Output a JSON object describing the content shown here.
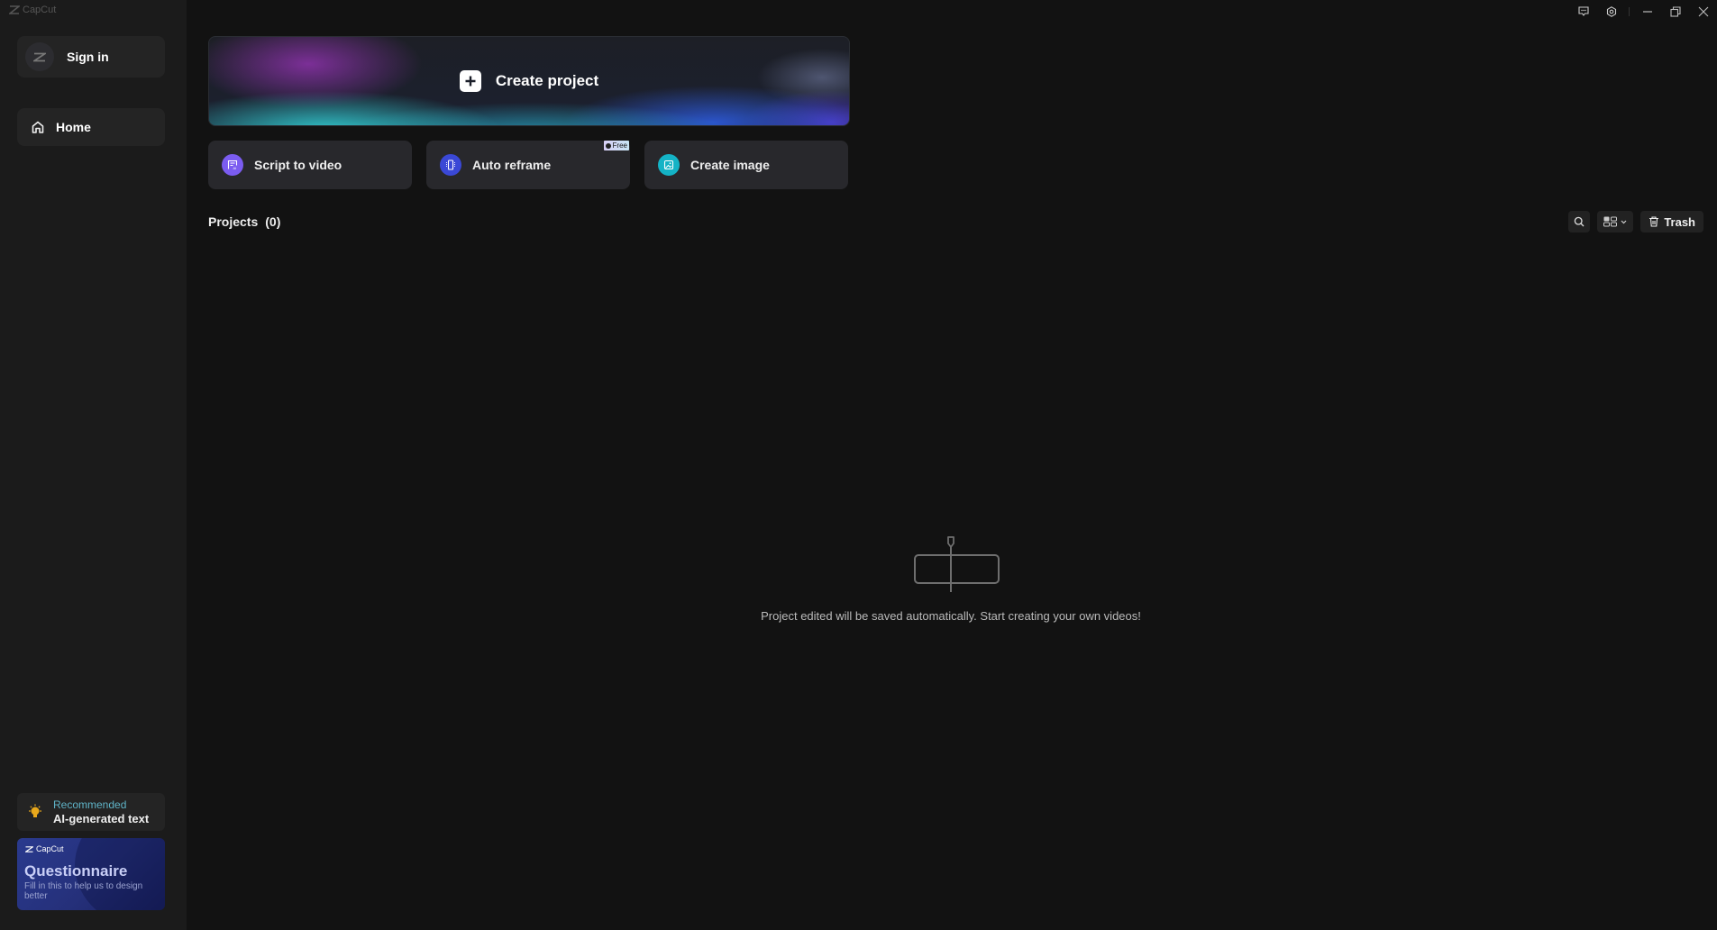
{
  "app": {
    "name": "CapCut"
  },
  "window_controls": [
    "feedback-icon",
    "settings-icon",
    "minimize-icon",
    "restore-icon",
    "close-icon"
  ],
  "sidebar": {
    "sign_in_label": "Sign in",
    "items": [
      {
        "label": "Home",
        "icon": "home-icon",
        "active": true
      }
    ],
    "recommended": {
      "kicker": "Recommended",
      "title": "AI-generated text",
      "icon": "lightbulb-icon"
    },
    "questionnaire": {
      "brand": "CapCut",
      "title": "Questionnaire",
      "subtitle": "Fill in this to help us to design better"
    }
  },
  "main": {
    "create_project_label": "Create project",
    "features": [
      {
        "label": "Script to video",
        "icon": "script-icon",
        "color": "#7b5cf0"
      },
      {
        "label": "Auto reframe",
        "icon": "reframe-icon",
        "color": "#3a48d6",
        "badge": "Free"
      },
      {
        "label": "Create image",
        "icon": "image-icon",
        "color": "#14b3c6"
      }
    ],
    "projects": {
      "label": "Projects",
      "count": "(0)"
    },
    "toolbar": {
      "trash_label": "Trash"
    },
    "empty_state": "Project edited will be saved automatically. Start creating your own videos!"
  }
}
